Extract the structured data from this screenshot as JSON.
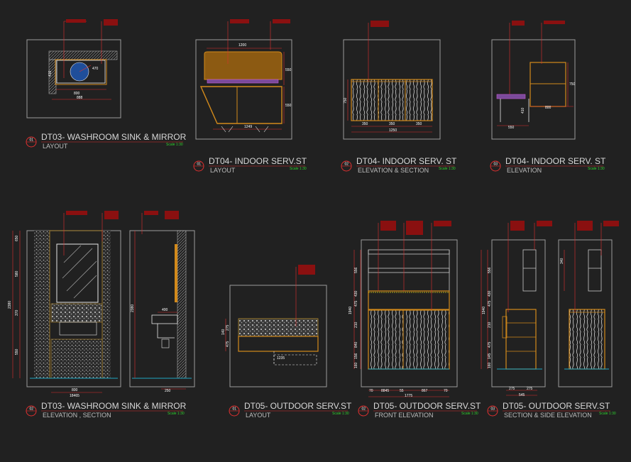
{
  "titles": [
    {
      "num": "01",
      "title": "DT03- WASHROOM SINK & MIRROR",
      "sub": "LAYOUT",
      "scale": "Scale 1:30"
    },
    {
      "num": "01",
      "title": "DT04- INDOOR SERV.ST",
      "sub": "LAYOUT",
      "scale": "Scale 1:30"
    },
    {
      "num": "02",
      "title": "DT04- INDOOR SERV. ST",
      "sub": "ELEVATION & SECTION",
      "scale": "Scale 1:30"
    },
    {
      "num": "03",
      "title": "DT04- INDOOR SERV. ST",
      "sub": "ELEVATION",
      "scale": "Scale 1:30"
    },
    {
      "num": "02",
      "title": "DT03- WASHROOM SINK & MIRROR",
      "sub": "ELEVATION , SECTION",
      "scale": "Scale 1:30"
    },
    {
      "num": "01",
      "title": "DT05- OUTDOOR SERV.ST",
      "sub": "LAYOUT",
      "scale": "Scale 1:30"
    },
    {
      "num": "02",
      "title": "DT05- OUTDOOR SERV.ST",
      "sub": "FRONT  ELEVATION",
      "scale": "Scale 1:30"
    },
    {
      "num": "03",
      "title": "DT05- OUTDOOR SERV.ST",
      "sub": "SECTION & SIDE  ELEVATION",
      "scale": "Scale 1:30"
    }
  ],
  "dims": {
    "d1": {
      "a": "470",
      "b": "410",
      "w1": "800",
      "w2": "888"
    },
    "d2": {
      "top": "1200",
      "r1": "550",
      "r2": "550",
      "bot": "1249"
    },
    "d3": {
      "h": "750",
      "w1": "350",
      "w2": "350",
      "w3": "350",
      "tot": "1250"
    },
    "d4": {
      "a": "750",
      "b": "410",
      "c": "800",
      "d": "550"
    },
    "d5": {
      "a": "650",
      "b": "580",
      "c": "370",
      "d": "550",
      "tot": "2380",
      "w": "800",
      "w2": "18465",
      "e": "400",
      "f": "250",
      "tot2": "2380"
    },
    "d6": {
      "a": "275",
      "b": "475",
      "tot": "140",
      "w": "1235"
    },
    "d7": {
      "v": [
        "556",
        "430",
        "475",
        "210",
        "840",
        "156",
        "160"
      ],
      "tot": "1940",
      "w1": "70",
      "w2": "8845",
      "w3": "55",
      "w4": "867",
      "w5": "70",
      "tot2": "1775"
    },
    "d8": {
      "v": [
        "556",
        "430",
        "475",
        "210",
        "475",
        "145",
        "160"
      ],
      "tot": "1940",
      "w1": "275",
      "w2": "275",
      "w3": "545",
      "side": "340"
    }
  }
}
